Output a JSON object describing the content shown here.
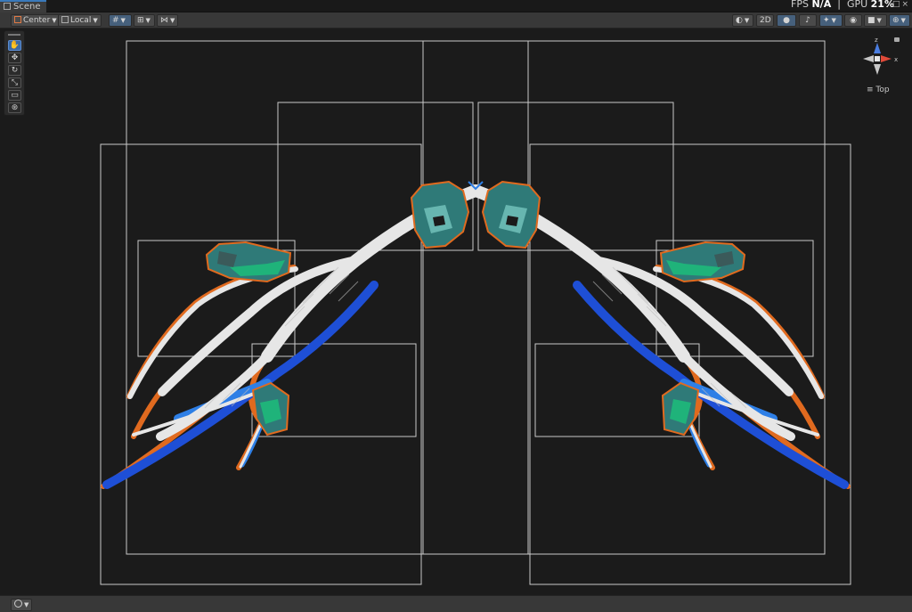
{
  "window": {
    "tab_title": "Scene",
    "stats": {
      "fps_label": "FPS",
      "fps_value": "N/A",
      "separator": "|",
      "gpu_label": "GPU",
      "gpu_value": "21%"
    }
  },
  "toolbar": {
    "pivot_mode": "Center",
    "pivot_rotation": "Local",
    "mode_2d_label": "2D"
  },
  "gizmo": {
    "view_label": "Top",
    "axis_z": "z",
    "axis_x": "x",
    "colors": {
      "z": "#4a7de0",
      "x": "#e04a3a",
      "neutral": "#c8c8c8"
    }
  },
  "scene": {
    "background": "#1b1b1b",
    "colors": {
      "antler": "#e6e6e6",
      "blue": "#2e7fe6",
      "dark_blue": "#1e4fd6",
      "outline": "#e06a1f",
      "teal": "#2f7a78",
      "green": "#1fb37a",
      "frame": "#c9c9c9"
    }
  }
}
